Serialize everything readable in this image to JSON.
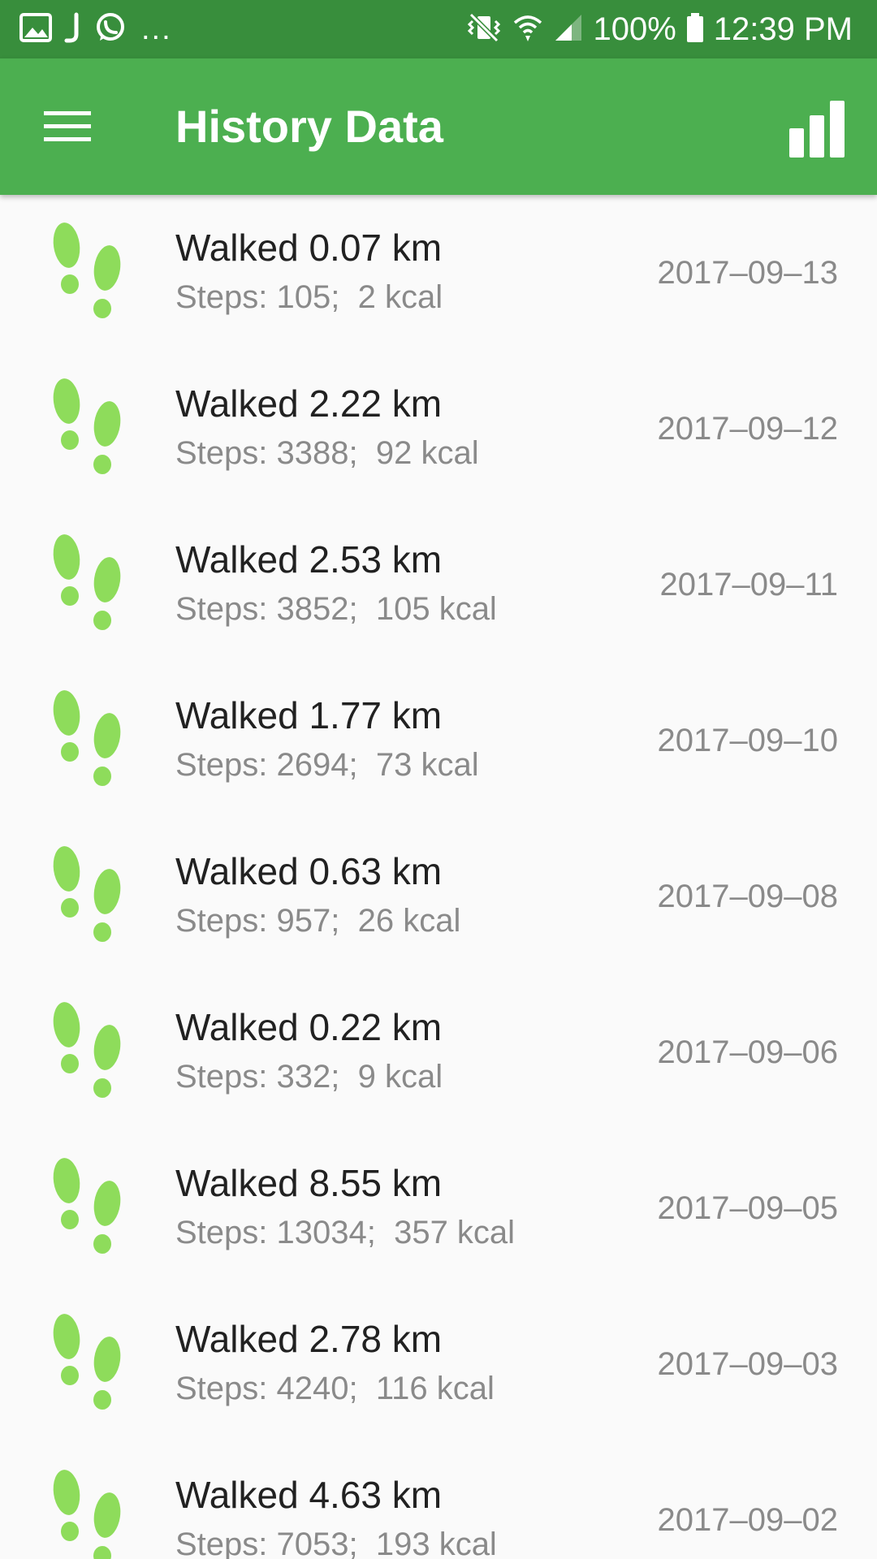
{
  "status_bar": {
    "left_icons": [
      "image-icon",
      "j-app-icon",
      "whatsapp-icon"
    ],
    "overflow": "...",
    "right_icons": [
      "vibrate-mute-icon",
      "wifi-icon",
      "signal-icon",
      "battery-icon"
    ],
    "battery": "100%",
    "time": "12:39 PM"
  },
  "app_bar": {
    "menu_icon": "hamburger-menu-icon",
    "title": "History Data",
    "chart_icon": "bar-chart-icon"
  },
  "colors": {
    "status_bar": "#388e3c",
    "app_bar": "#4caf50",
    "footprint": "#8edc5b"
  },
  "history": [
    {
      "title": "Walked 0.07 km",
      "sub": "Steps: 105;  2 kcal",
      "date": "2017–09–13"
    },
    {
      "title": "Walked 2.22 km",
      "sub": "Steps: 3388;  92 kcal",
      "date": "2017–09–12"
    },
    {
      "title": "Walked 2.53 km",
      "sub": "Steps: 3852;  105 kcal",
      "date": "2017–09–11"
    },
    {
      "title": "Walked 1.77 km",
      "sub": "Steps: 2694;  73 kcal",
      "date": "2017–09–10"
    },
    {
      "title": "Walked 0.63 km",
      "sub": "Steps: 957;  26 kcal",
      "date": "2017–09–08"
    },
    {
      "title": "Walked 0.22 km",
      "sub": "Steps: 332;  9 kcal",
      "date": "2017–09–06"
    },
    {
      "title": "Walked 8.55 km",
      "sub": "Steps: 13034;  357 kcal",
      "date": "2017–09–05"
    },
    {
      "title": "Walked 2.78 km",
      "sub": "Steps: 4240;  116 kcal",
      "date": "2017–09–03"
    },
    {
      "title": "Walked 4.63 km",
      "sub": "Steps: 7053;  193 kcal",
      "date": "2017–09–02"
    }
  ]
}
